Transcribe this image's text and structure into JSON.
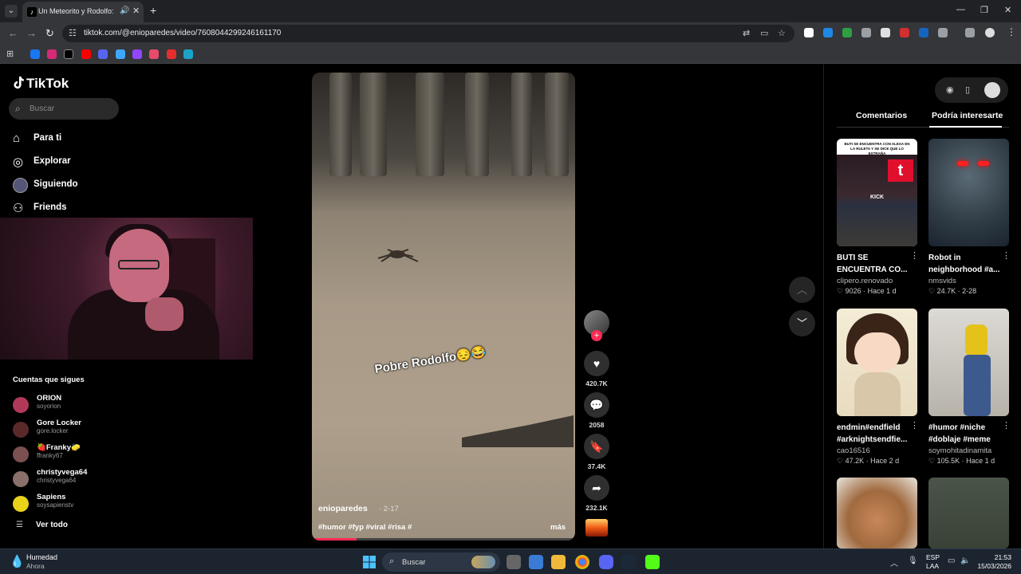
{
  "browser": {
    "tab_title": "Un Meteorito y Rodolfo: Hu",
    "url": "tiktok.com/@enioparedes/video/7608044299246161170"
  },
  "sidebar": {
    "logo": "TikTok",
    "search_placeholder": "Buscar",
    "nav": [
      {
        "label": "Para ti",
        "icon": "home-icon"
      },
      {
        "label": "Explorar",
        "icon": "compass-icon"
      },
      {
        "label": "Siguiendo",
        "icon": "following-avatar-icon"
      },
      {
        "label": "Friends",
        "icon": "friends-icon"
      }
    ],
    "following_heading": "Cuentas que sigues",
    "following": [
      {
        "name": "ORION",
        "handle": "soyorion",
        "color": "#b0395a"
      },
      {
        "name": "Gore Locker",
        "handle": "gore.locker",
        "color": "#5a2a2a"
      },
      {
        "name": "🍓Franky🧽",
        "handle": "ffranky67",
        "color": "#7a5050"
      },
      {
        "name": "christyvega64",
        "handle": "christyvega64",
        "color": "#8a6f6a"
      },
      {
        "name": "Sapiens",
        "handle": "soysapienstv",
        "color": "#e8d21a"
      }
    ],
    "see_all": "Ver todo"
  },
  "video": {
    "caption_overlay": "Pobre Rodolfo😔😂",
    "author": "enioparedes",
    "date": "· 2-17",
    "tags": "#humor #fyp #viral #risa #",
    "more": "más",
    "progress": 0.17
  },
  "actions": {
    "likes": "420.7K",
    "comments": "2058",
    "saves": "37.4K",
    "shares": "232.1K"
  },
  "right_panel": {
    "tabs": [
      "Comentarios",
      "Podría interesarte"
    ],
    "active_tab": "Podría interesarte",
    "cards": [
      {
        "title": "BUTI SE ENCUENTRA CO...",
        "author": "clipero.renovado",
        "likes": "9026",
        "age": "Hace 1 d",
        "thumb_caption": "BUTI SE ENCUENTRA CON ALEXA EN LA RULETA Y SE DICE QUE LO EXTRAÑA",
        "thumb_badge": "KICK"
      },
      {
        "title": "Robot in neighborhood #a...",
        "author": "nmsvids",
        "likes": "24.7K",
        "age": "2-28"
      },
      {
        "title": "endmin#endfield #arknightsendfie...",
        "author": "cao16516",
        "likes": "47.2K",
        "age": "Hace 2 d"
      },
      {
        "title": "#humor #niche #doblaje #meme",
        "author": "soymohitadinamita",
        "likes": "105.5K",
        "age": "Hace 1 d"
      }
    ]
  },
  "taskbar": {
    "weather_title": "Humedad",
    "weather_sub": "Ahora",
    "search": "Buscar",
    "lang1": "ESP",
    "lang2": "LAA",
    "time": "21:53",
    "date": "15/03/2026"
  }
}
